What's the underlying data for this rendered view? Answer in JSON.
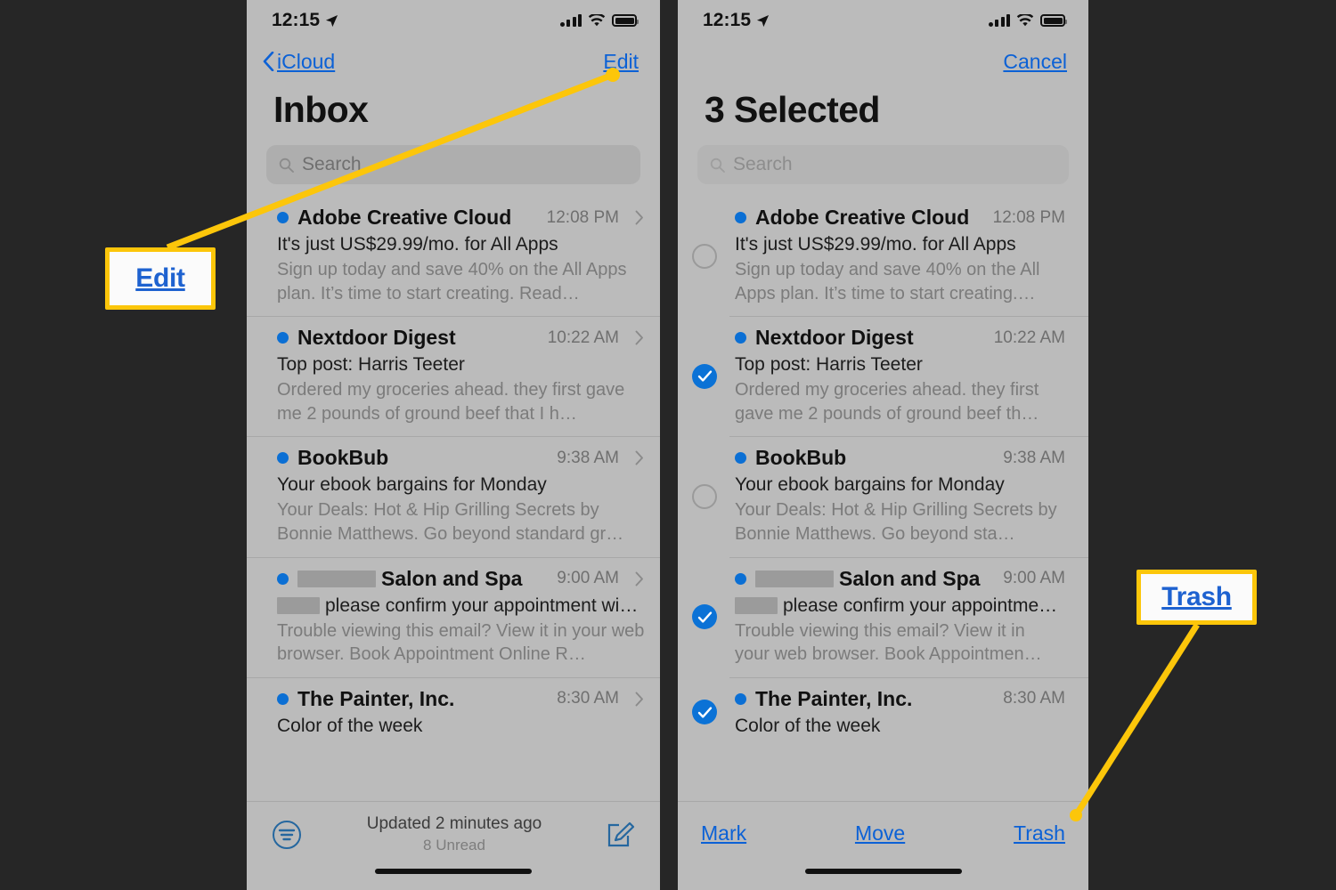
{
  "background_color": "#262626",
  "accent_blue": "#0b6fd4",
  "link_blue": "#0b61d6",
  "highlight_yellow": "#fcc60a",
  "status_bar": {
    "time": "12:15",
    "location_icon": "location-arrow-icon",
    "signal_icon": "cellular-signal-icon",
    "wifi_icon": "wifi-icon",
    "battery_icon": "battery-full-icon"
  },
  "left_phone": {
    "nav": {
      "back_label": "iCloud",
      "back_icon": "chevron-left-icon",
      "action_label": "Edit"
    },
    "title": "Inbox",
    "search": {
      "placeholder": "Search",
      "icon": "search-icon"
    },
    "emails": [
      {
        "sender": "Adobe Creative Cloud",
        "sender_redacted_width": 0,
        "time": "12:08 PM",
        "subject": "It's just US$29.99/mo. for All Apps",
        "subject_redacted_width": 0,
        "preview": "Sign up today and save 40% on the All Apps plan. It’s time to start creating. Read…",
        "unread": true,
        "chevron": true
      },
      {
        "sender": "Nextdoor Digest",
        "sender_redacted_width": 0,
        "time": "10:22 AM",
        "subject": "Top post: Harris Teeter",
        "subject_redacted_width": 0,
        "preview": "Ordered my groceries ahead. they first gave me 2 pounds of ground beef that I h…",
        "unread": true,
        "chevron": true
      },
      {
        "sender": "BookBub",
        "sender_redacted_width": 0,
        "time": "9:38 AM",
        "subject": "Your ebook bargains for Monday",
        "subject_redacted_width": 0,
        "preview": "Your Deals: Hot & Hip Grilling Secrets by Bonnie Matthews. Go beyond standard gr…",
        "unread": true,
        "chevron": true
      },
      {
        "sender": "Salon and Spa",
        "sender_redacted_width": 88,
        "time": "9:00 AM",
        "subject": "please confirm your appointment wi…",
        "subject_redacted_width": 48,
        "preview": "Trouble viewing this email? View it in your web browser. Book Appointment Online R…",
        "unread": true,
        "chevron": true
      },
      {
        "sender": "The Painter, Inc.",
        "sender_redacted_width": 0,
        "time": "8:30 AM",
        "subject": "Color of the week",
        "subject_redacted_width": 0,
        "preview": "",
        "unread": true,
        "chevron": true
      }
    ],
    "toolbar": {
      "filter_icon": "filter-icon",
      "update_status": "Updated 2 minutes ago",
      "unread_count": "8 Unread",
      "compose_icon": "compose-icon"
    }
  },
  "right_phone": {
    "nav": {
      "action_label": "Cancel"
    },
    "title": "3 Selected",
    "search": {
      "placeholder": "Search",
      "icon": "search-icon"
    },
    "emails": [
      {
        "sender": "Adobe Creative Cloud",
        "sender_redacted_width": 0,
        "time": "12:08 PM",
        "subject": "It's just US$29.99/mo. for All Apps",
        "subject_redacted_width": 0,
        "preview": "Sign up today and save 40% on the All Apps plan. It’s time to start creating.…",
        "unread": true,
        "selected": false
      },
      {
        "sender": "Nextdoor Digest",
        "sender_redacted_width": 0,
        "time": "10:22 AM",
        "subject": "Top post: Harris Teeter",
        "subject_redacted_width": 0,
        "preview": "Ordered my groceries ahead. they first gave me 2 pounds of ground beef th…",
        "unread": true,
        "selected": true
      },
      {
        "sender": "BookBub",
        "sender_redacted_width": 0,
        "time": "9:38 AM",
        "subject": "Your ebook bargains for Monday",
        "subject_redacted_width": 0,
        "preview": "Your Deals: Hot & Hip Grilling Secrets by Bonnie Matthews. Go beyond sta…",
        "unread": true,
        "selected": false
      },
      {
        "sender": "Salon and Spa",
        "sender_redacted_width": 88,
        "time": "9:00 AM",
        "subject": "please confirm your appointme…",
        "subject_redacted_width": 48,
        "preview": "Trouble viewing this email? View it in your web browser. Book Appointmen…",
        "unread": true,
        "selected": true
      },
      {
        "sender": "The Painter, Inc.",
        "sender_redacted_width": 0,
        "time": "8:30 AM",
        "subject": "Color of the week",
        "subject_redacted_width": 0,
        "preview": "",
        "unread": true,
        "selected": true
      }
    ],
    "toolbar": {
      "mark": "Mark",
      "move": "Move",
      "trash": "Trash"
    }
  },
  "annotations": [
    {
      "label": "Edit",
      "name": "callout-edit"
    },
    {
      "label": "Trash",
      "name": "callout-trash"
    }
  ]
}
